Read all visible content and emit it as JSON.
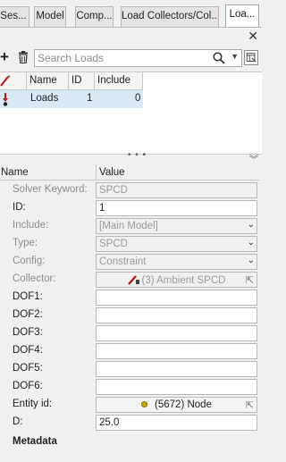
{
  "tabs": [
    {
      "label": "Ses..."
    },
    {
      "label": "Model"
    },
    {
      "label": "Comp..."
    },
    {
      "label": "Load Collectors/Col..."
    },
    {
      "label": "Loa...",
      "active": true
    }
  ],
  "toolbar": {
    "add_label": "+",
    "close_label": "✕",
    "search_placeholder": "Search Loads"
  },
  "loads_table": {
    "columns": [
      "Name",
      "ID",
      "Include"
    ],
    "rows": [
      {
        "name": "Loads",
        "id": "1",
        "include": "0"
      }
    ]
  },
  "splitter": {
    "dots": "• • •",
    "chevron": "⌄"
  },
  "property_grid": {
    "header": {
      "name": "Name",
      "value": "Value"
    },
    "rows": [
      {
        "label": "Solver Keyword:",
        "value": "SPCD"
      },
      {
        "label": "ID:",
        "value": "1"
      },
      {
        "label": "Include:",
        "value": "[Main Model]"
      },
      {
        "label": "Type:",
        "value": "SPCD"
      },
      {
        "label": "Config:",
        "value": "Constraint"
      },
      {
        "label": "Collector:",
        "value": "(3) Ambient SPCD"
      },
      {
        "label": "DOF1:",
        "value": ""
      },
      {
        "label": "DOF2:",
        "value": ""
      },
      {
        "label": "DOF3:",
        "value": ""
      },
      {
        "label": "DOF4:",
        "value": ""
      },
      {
        "label": "DOF5:",
        "value": ""
      },
      {
        "label": "DOF6:",
        "value": ""
      },
      {
        "label": "Entity id:",
        "value": "(5672) Node"
      },
      {
        "label": "D:",
        "value": "25.0"
      }
    ],
    "section": "Metadata"
  },
  "colors": {
    "selected_row": "#d8e9f6",
    "panel_bg": "#f0f0f0",
    "node_dot": "#c9a800",
    "load_icon": "#c0141a"
  }
}
